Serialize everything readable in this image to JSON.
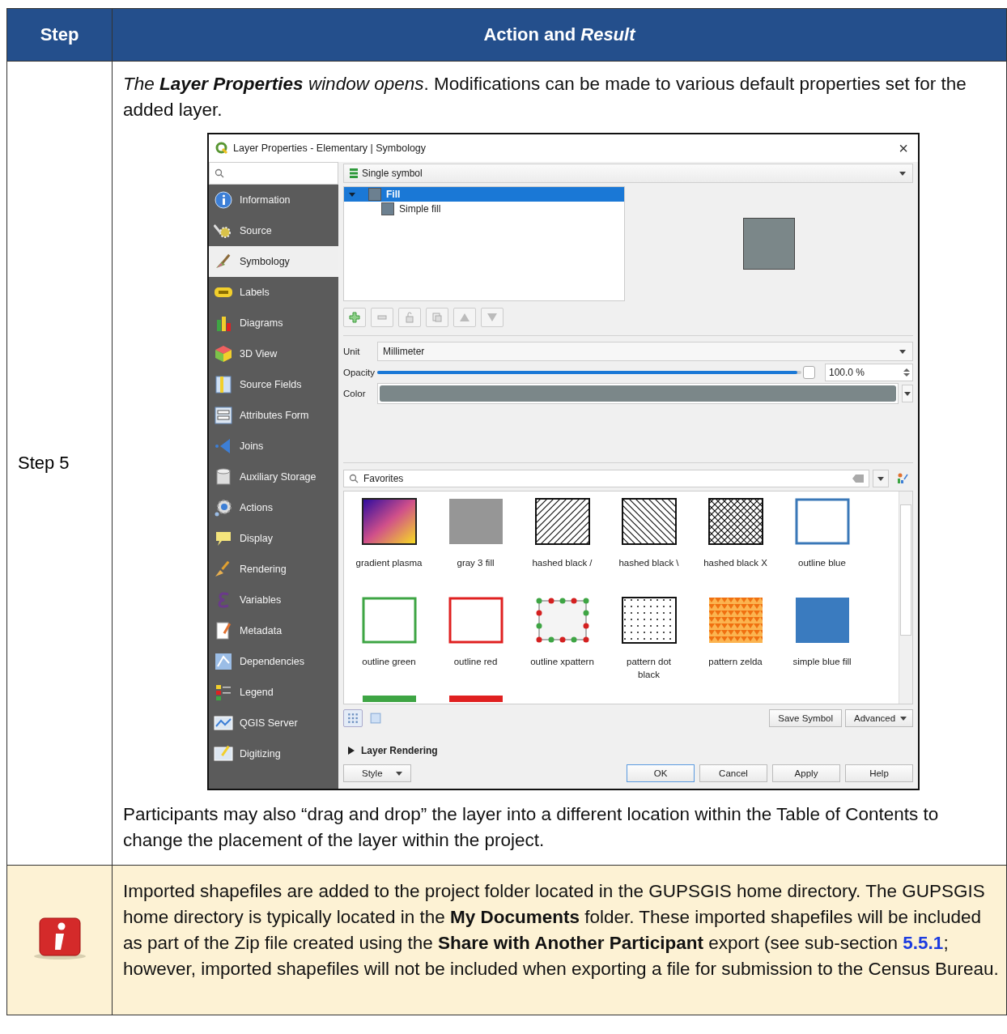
{
  "table": {
    "columns": [
      "Step",
      "Action and *Result*"
    ],
    "rows": [
      {
        "kind": "step",
        "step": "Step 5",
        "intro_lead": "The **Layer Properties** window opens",
        "intro_rest": ". Modifications can be made to various default properties set for the added layer.",
        "dialog": {
          "title": "Layer Properties - Elementary | Symbology",
          "close": "×",
          "sidebar": [
            {
              "label": "Information",
              "selected": false
            },
            {
              "label": "Source",
              "selected": false
            },
            {
              "label": "Symbology",
              "selected": true
            },
            {
              "label": "Labels",
              "selected": false
            },
            {
              "label": "Diagrams",
              "selected": false
            },
            {
              "label": "3D View",
              "selected": false
            },
            {
              "label": "Source Fields",
              "selected": false
            },
            {
              "label": "Attributes Form",
              "selected": false
            },
            {
              "label": "Joins",
              "selected": false
            },
            {
              "label": "Auxiliary Storage",
              "selected": false
            },
            {
              "label": "Actions",
              "selected": false
            },
            {
              "label": "Display",
              "selected": false
            },
            {
              "label": "Rendering",
              "selected": false
            },
            {
              "label": "Variables",
              "selected": false
            },
            {
              "label": "Metadata",
              "selected": false
            },
            {
              "label": "Dependencies",
              "selected": false
            },
            {
              "label": "Legend",
              "selected": false
            },
            {
              "label": "QGIS Server",
              "selected": false
            },
            {
              "label": "Digitizing",
              "selected": false
            }
          ],
          "renderer": "Single symbol",
          "tree": [
            {
              "label": "Fill",
              "selected": true,
              "expanded": true,
              "children": [
                {
                  "label": "Simple fill",
                  "selected": false
                }
              ]
            }
          ],
          "unit_label": "Unit",
          "unit": "Millimeter",
          "opacity_label": "Opacity",
          "opacity": {
            "level": 0.99,
            "reading": "100.0 %"
          },
          "color_label": "Color",
          "library_filter": "Favorites",
          "symbols": [
            {
              "label": "gradient plasma",
              "kind": "gradient"
            },
            {
              "label": "gray 3 fill",
              "kind": "solid",
              "color": "#969696"
            },
            {
              "label": "hashed black /",
              "kind": "slash"
            },
            {
              "label": "hashed black \\",
              "kind": "backslash"
            },
            {
              "label": "hashed black X",
              "kind": "crosshatch"
            },
            {
              "label": "outline blue",
              "kind": "outline",
              "color": "#3a78b8"
            },
            {
              "label": "outline green",
              "kind": "outline",
              "color": "#3ea544"
            },
            {
              "label": "outline red",
              "kind": "outline",
              "color": "#e02020"
            },
            {
              "label": "outline xpattern",
              "kind": "markers"
            },
            {
              "label": "pattern dot black",
              "kind": "dots"
            },
            {
              "label": "pattern zelda",
              "kind": "zelda"
            },
            {
              "label": "simple blue fill",
              "kind": "solid",
              "color": "#3a7bbf"
            }
          ],
          "partial_symbols": [
            {
              "kind": "solid",
              "color": "#3ea544"
            },
            {
              "kind": "solid",
              "color": "#e02020"
            }
          ],
          "save_symbol": "Save Symbol",
          "advanced": "Advanced",
          "section": {
            "label": "Layer Rendering",
            "expanded": false
          },
          "style": "Style",
          "buttons": [
            {
              "label": "OK",
              "default": true
            },
            {
              "label": "Cancel",
              "default": false
            },
            {
              "label": "Apply",
              "default": false
            },
            {
              "label": "Help",
              "default": false
            }
          ]
        },
        "outro": "Participants may also “drag and drop” the layer into a different location within the Table of Contents to change the placement of the layer within the project."
      },
      {
        "kind": "note",
        "text_before": "Imported shapefiles are added to the project folder located in the GUPSGIS home directory. The GUPSGIS home directory is typically located in the **My Documents** folder. These imported shapefiles will be included as part of the Zip file created using the **Share with Another Participant** export (see sub-section ",
        "link": "5.5.1",
        "text_after": "; however, imported shapefiles will not be included when exporting a file for submission to the Census Bureau."
      }
    ]
  }
}
